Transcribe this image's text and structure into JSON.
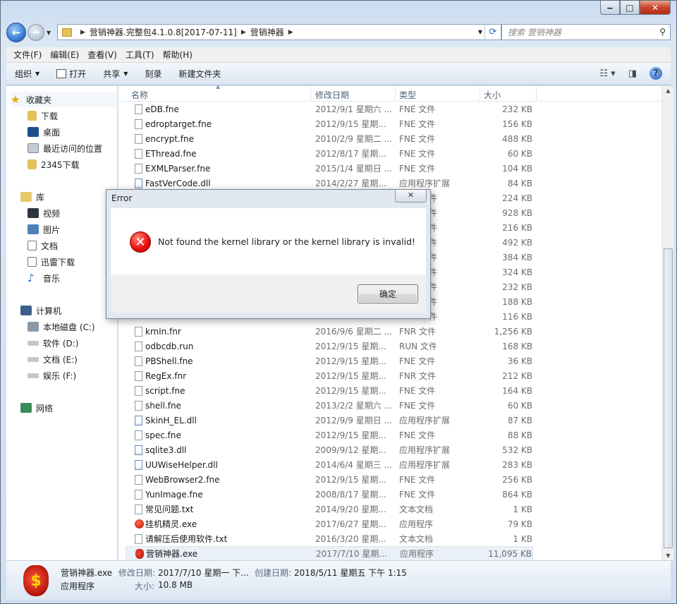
{
  "window": {
    "minimize": "‒",
    "maximize": "□",
    "close": "✕"
  },
  "nav": {
    "back": "←",
    "forward": "→"
  },
  "address": {
    "crumbs": [
      "营销神器.完整包4.1.0.8[2017-07-11]",
      "营销神器"
    ]
  },
  "search": {
    "placeholder": "搜索 营销神器"
  },
  "menu": [
    "文件(F)",
    "编辑(E)",
    "查看(V)",
    "工具(T)",
    "帮助(H)"
  ],
  "toolbar": {
    "organize": "组织",
    "open": "打开",
    "share": "共享",
    "burn": "刻录",
    "new_folder": "新建文件夹"
  },
  "sidebar": {
    "favorites": "收藏夹",
    "fav_items": [
      "下载",
      "桌面",
      "最近访问的位置",
      "2345下载"
    ],
    "library": "库",
    "lib_items": [
      "视频",
      "图片",
      "文档",
      "迅雷下载",
      "音乐"
    ],
    "computer": "计算机",
    "drives": [
      "本地磁盘 (C:)",
      "软件 (D:)",
      "文档 (E:)",
      "娱乐 (F:)"
    ],
    "network": "网络"
  },
  "columns": {
    "name": "名称",
    "date": "修改日期",
    "type": "类型",
    "size": "大小"
  },
  "files_top": [
    {
      "name": "eDB.fne",
      "date": "2012/9/1 星期六 ...",
      "type": "FNE 文件",
      "size": "232 KB",
      "icon": "file"
    },
    {
      "name": "edroptarget.fne",
      "date": "2012/9/15 星期...",
      "type": "FNE 文件",
      "size": "156 KB",
      "icon": "file"
    },
    {
      "name": "encrypt.fne",
      "date": "2010/2/9 星期二 ...",
      "type": "FNE 文件",
      "size": "488 KB",
      "icon": "file"
    },
    {
      "name": "EThread.fne",
      "date": "2012/8/17 星期...",
      "type": "FNE 文件",
      "size": "60 KB",
      "icon": "file"
    },
    {
      "name": "EXMLParser.fne",
      "date": "2015/1/4 星期日 ...",
      "type": "FNE 文件",
      "size": "104 KB",
      "icon": "file"
    },
    {
      "name": "FastVerCode.dll",
      "date": "2014/2/27 星期...",
      "type": "应用程序扩展",
      "size": "84 KB",
      "icon": "dll"
    }
  ],
  "hidden_sizes": [
    "224 KB",
    "928 KB",
    "216 KB",
    "492 KB",
    "384 KB",
    "324 KB",
    "232 KB",
    "188 KB",
    "116 KB"
  ],
  "files_bottom": [
    {
      "name": "krnln.fnr",
      "date": "2016/9/6 星期二 ...",
      "type": "FNR 文件",
      "size": "1,256 KB",
      "icon": "file"
    },
    {
      "name": "odbcdb.run",
      "date": "2012/9/15 星期...",
      "type": "RUN 文件",
      "size": "168 KB",
      "icon": "file"
    },
    {
      "name": "PBShell.fne",
      "date": "2012/9/15 星期...",
      "type": "FNE 文件",
      "size": "36 KB",
      "icon": "file"
    },
    {
      "name": "RegEx.fnr",
      "date": "2012/9/15 星期...",
      "type": "FNR 文件",
      "size": "212 KB",
      "icon": "file"
    },
    {
      "name": "script.fne",
      "date": "2012/9/15 星期...",
      "type": "FNE 文件",
      "size": "164 KB",
      "icon": "file"
    },
    {
      "name": "shell.fne",
      "date": "2013/2/2 星期六 ...",
      "type": "FNE 文件",
      "size": "60 KB",
      "icon": "file"
    },
    {
      "name": "SkinH_EL.dll",
      "date": "2012/9/9 星期日 ...",
      "type": "应用程序扩展",
      "size": "87 KB",
      "icon": "dll"
    },
    {
      "name": "spec.fne",
      "date": "2012/9/15 星期...",
      "type": "FNE 文件",
      "size": "88 KB",
      "icon": "file"
    },
    {
      "name": "sqlite3.dll",
      "date": "2009/9/12 星期...",
      "type": "应用程序扩展",
      "size": "532 KB",
      "icon": "dll"
    },
    {
      "name": "UUWiseHelper.dll",
      "date": "2014/6/4 星期三 ...",
      "type": "应用程序扩展",
      "size": "283 KB",
      "icon": "dll"
    },
    {
      "name": "WebBrowser2.fne",
      "date": "2012/9/15 星期...",
      "type": "FNE 文件",
      "size": "256 KB",
      "icon": "file"
    },
    {
      "name": "YunImage.fne",
      "date": "2008/8/17 星期...",
      "type": "FNE 文件",
      "size": "864 KB",
      "icon": "file"
    },
    {
      "name": "常见问题.txt",
      "date": "2014/9/20 星期...",
      "type": "文本文档",
      "size": "1 KB",
      "icon": "file"
    },
    {
      "name": "挂机精灵.exe",
      "date": "2017/6/27 星期...",
      "type": "应用程序",
      "size": "79 KB",
      "icon": "exe"
    },
    {
      "name": "请解压后使用软件.txt",
      "date": "2016/3/20 星期...",
      "type": "文本文档",
      "size": "1 KB",
      "icon": "file"
    },
    {
      "name": "营销神器.exe",
      "date": "2017/7/10 星期...",
      "type": "应用程序",
      "size": "11,095 KB",
      "icon": "bag",
      "selected": true
    }
  ],
  "details": {
    "name": "营销神器.exe",
    "kind": "应用程序",
    "modified_label": "修改日期:",
    "modified": "2017/7/10 星期一 下...",
    "created_label": "创建日期:",
    "created": "2018/5/11 星期五 下午 1:15",
    "size_label": "大小:",
    "size": "10.8 MB",
    "icon_glyph": "$"
  },
  "dialog": {
    "title": "Error",
    "close": "✕",
    "message": "Not found the kernel library or the kernel library is invalid!",
    "ok": "确定"
  }
}
